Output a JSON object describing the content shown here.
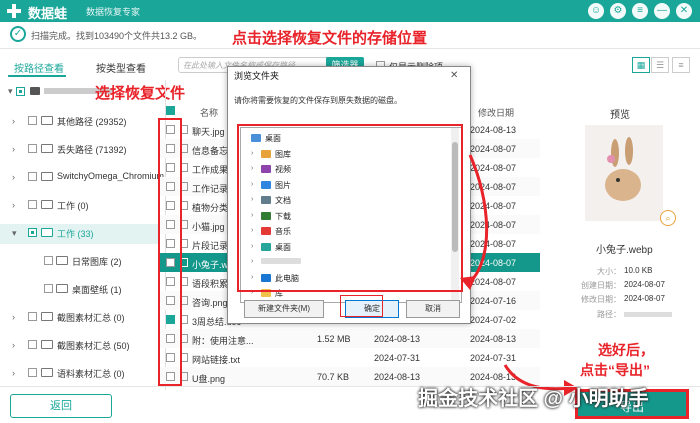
{
  "titlebar": {
    "app_name": "数据蛙",
    "subtitle": "数据恢复专家",
    "buttons": [
      "☺",
      "⚙",
      "≡",
      "—",
      "✕"
    ]
  },
  "scan": {
    "status": "扫描完成。找到103490个文件共13.2 GB。"
  },
  "annotations": {
    "choose_location": "点击选择恢复文件的存储位置",
    "choose_files": "选择恢复文件",
    "after_select_line1": "选好后，",
    "after_select_line2": "点击“导出”"
  },
  "tabs": [
    "按路径查看",
    "按类型查看"
  ],
  "filter": {
    "search_placeholder": "在此处输入文件名称或保存路径",
    "filter_button": "筛选器",
    "only_show_deleted": "仅显示删除项"
  },
  "tree": [
    {
      "label": "其他路径 (29352)"
    },
    {
      "label": "丢失路径 (71392)"
    },
    {
      "label": "SwitchyOmega_Chromium"
    },
    {
      "label": "工作 (0)"
    },
    {
      "label": "工作 (33)"
    },
    {
      "label": "日常图库 (2)"
    },
    {
      "label": "桌面壁纸 (1)"
    },
    {
      "label": "截图素材汇总 (0)"
    },
    {
      "label": "截图素材汇总 (50)"
    },
    {
      "label": "语料素材汇总 (0)"
    }
  ],
  "file_table": {
    "header_name": "名称",
    "header_modified": "修改日期",
    "rows": [
      {
        "name": "聊天.jpg",
        "size": "",
        "created": "",
        "modified": "2024-08-13"
      },
      {
        "name": "信息备忘.t",
        "size": "",
        "created": "",
        "modified": "2024-08-07"
      },
      {
        "name": "工作成果分",
        "size": "",
        "created": "",
        "modified": "2024-08-07"
      },
      {
        "name": "工作记录表",
        "size": "",
        "created": "",
        "modified": "2024-08-07"
      },
      {
        "name": "植物分类.d",
        "size": "",
        "created": "",
        "modified": "2024-08-07"
      },
      {
        "name": "小猫.jpg",
        "size": "",
        "created": "",
        "modified": "2024-08-07"
      },
      {
        "name": "片段记录.d",
        "size": "",
        "created": "",
        "modified": "2024-08-07"
      },
      {
        "name": "小兔子.web",
        "size": "",
        "created": "",
        "modified": "2024-08-07"
      },
      {
        "name": "语段积累.d",
        "size": "",
        "created": "",
        "modified": "2024-08-07"
      },
      {
        "name": "咨询.png",
        "size": "",
        "created": "",
        "modified": "2024-07-16"
      },
      {
        "name": "3周总结.doc",
        "size": "",
        "created": "",
        "modified": "2024-07-02"
      },
      {
        "name": "附：使用注意...",
        "size": "1.52 MB",
        "created": "2024-08-13",
        "modified": "2024-08-13"
      },
      {
        "name": "网站链接.txt",
        "size": "",
        "created": "2024-07-31",
        "modified": "2024-07-31"
      },
      {
        "name": "U盘.png",
        "size": "70.7 KB",
        "created": "2024-08-13",
        "modified": "2024-08-13"
      }
    ]
  },
  "preview": {
    "title": "预览",
    "file_name": "小兔子.webp",
    "size_label": "大小：",
    "size_value": "10.0 KB",
    "created_label": "创建日期：",
    "created_value": "2024-08-07",
    "modified_label": "修改日期：",
    "modified_value": "2024-08-07",
    "path_label": "路径："
  },
  "dialog": {
    "title": "浏览文件夹",
    "message": "请你将需要恢复的文件保存到原失数据的磁盘。",
    "items": [
      {
        "label": "桌面",
        "indent": 0
      },
      {
        "label": "图库",
        "indent": 1
      },
      {
        "label": "视频",
        "indent": 1
      },
      {
        "label": "图片",
        "indent": 1
      },
      {
        "label": "文档",
        "indent": 1
      },
      {
        "label": "下载",
        "indent": 1
      },
      {
        "label": "音乐",
        "indent": 1
      },
      {
        "label": "桌面",
        "indent": 1
      },
      {
        "label": "",
        "indent": 1
      },
      {
        "label": "此电脑",
        "indent": 1
      },
      {
        "label": "库",
        "indent": 1
      }
    ],
    "new_folder": "新建文件夹(M)",
    "ok": "确定",
    "cancel": "取消"
  },
  "buttons": {
    "back": "返回",
    "export": "导出"
  },
  "watermark": "掘金技术社区 @ 小明助手",
  "colors": {
    "accent": "#1aa79a",
    "annotation": "#e8232a"
  }
}
